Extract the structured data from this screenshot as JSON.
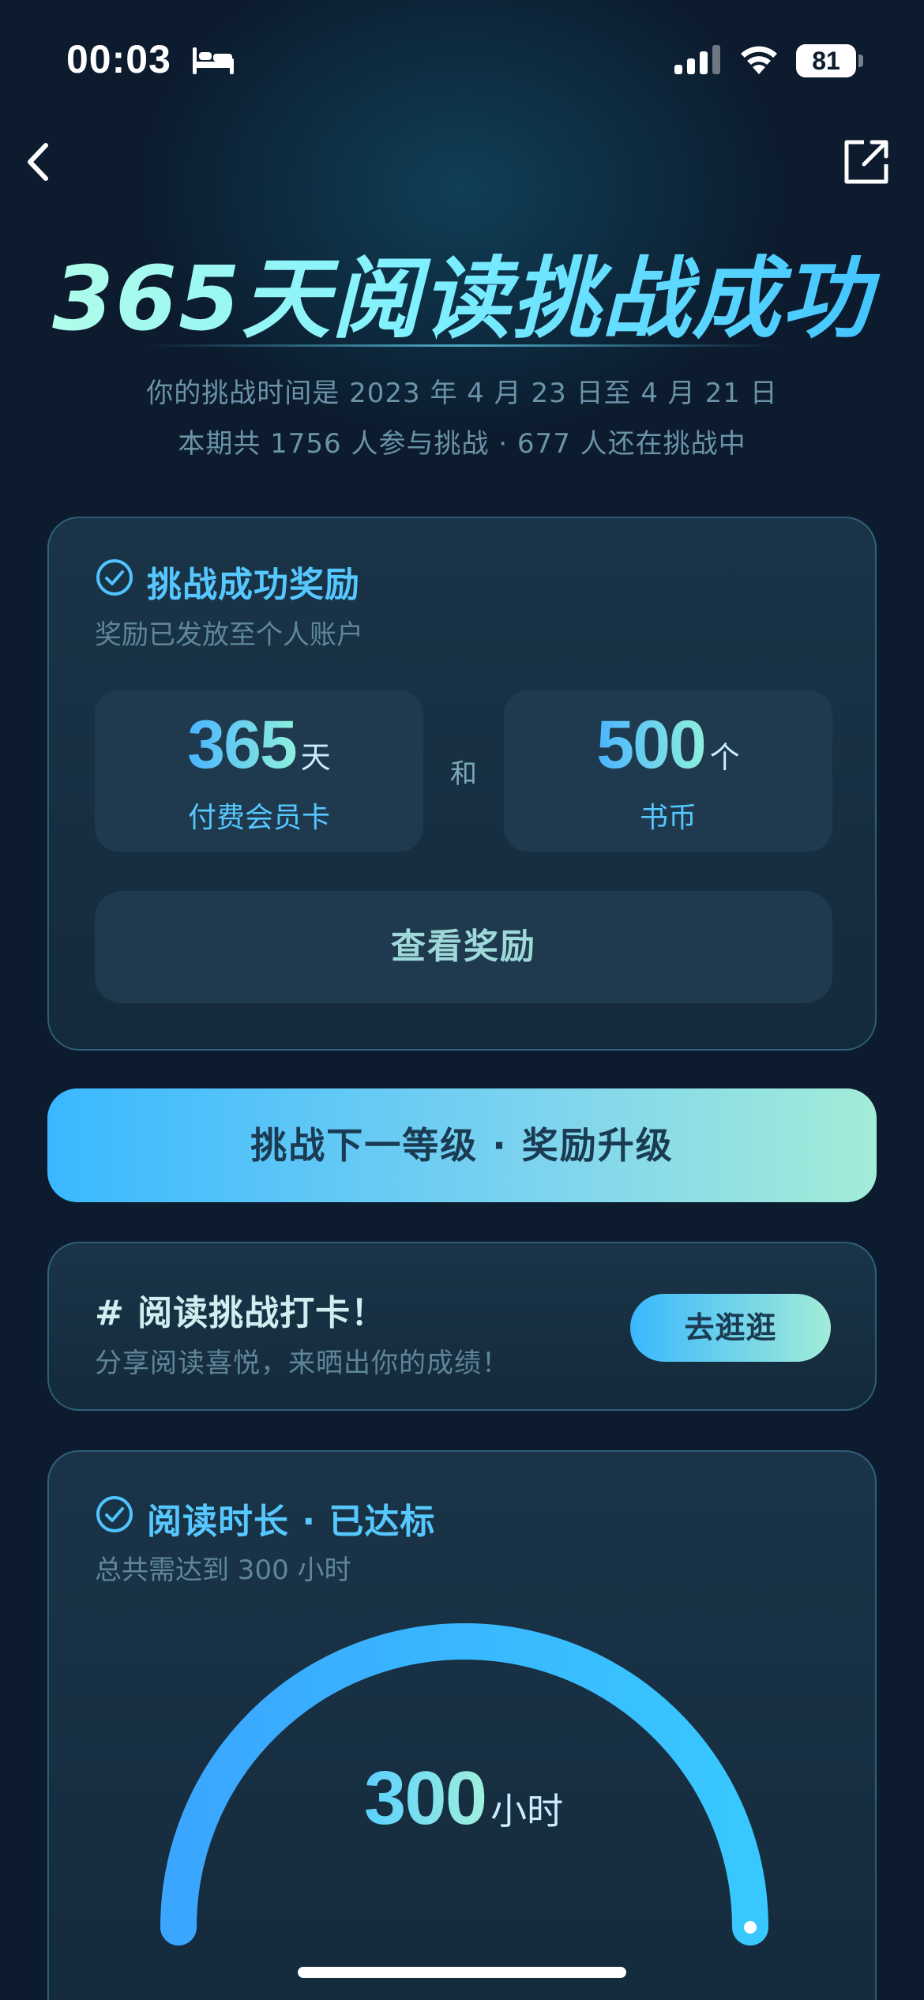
{
  "status_bar": {
    "time": "00:03",
    "battery": "81",
    "icons": [
      "bed-icon",
      "signal-icon",
      "wifi-icon",
      "battery-icon"
    ]
  },
  "nav": {
    "back_icon": "chevron-left-icon",
    "share_icon": "share-external-icon"
  },
  "hero": {
    "title": "365天阅读挑战成功",
    "line1": "你的挑战时间是 2023 年 4 月 23 日至 4 月 21 日",
    "line2": "本期共 1756 人参与挑战 · 677 人还在挑战中"
  },
  "reward_card": {
    "title": "挑战成功奖励",
    "subtitle": "奖励已发放至个人账户",
    "and_text": "和",
    "items": [
      {
        "value": "365",
        "unit": "天",
        "label": "付费会员卡"
      },
      {
        "value": "500",
        "unit": "个",
        "label": "书币"
      }
    ],
    "view_button": "查看奖励"
  },
  "upgrade_button": "挑战下一等级 · 奖励升级",
  "checkin_card": {
    "title": "# 阅读挑战打卡！",
    "subtitle": "分享阅读喜悦，来晒出你的成绩！",
    "button": "去逛逛"
  },
  "duration_card": {
    "title": "阅读时长 · 已达标",
    "subtitle": "总共需达到 300 小时",
    "value": "300",
    "unit": "小时",
    "progress": 1.0
  },
  "colors": {
    "background": "#0c1b2d",
    "accent_blue": "#56c8ff",
    "accent_mint": "#a2ecd8",
    "card": "#1c364a"
  }
}
